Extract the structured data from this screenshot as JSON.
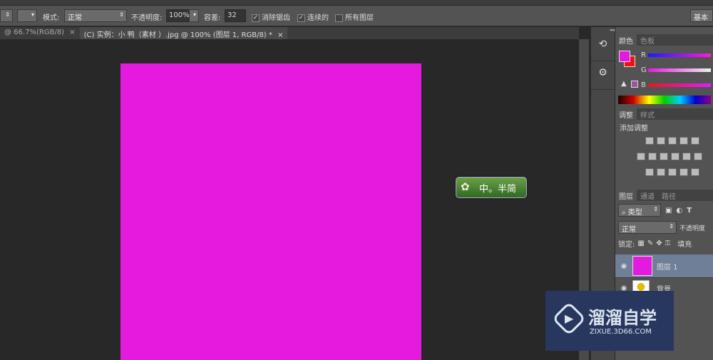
{
  "options": {
    "mode_label": "模式:",
    "mode_value": "正常",
    "opacity_label": "不透明度:",
    "opacity_value": "100%",
    "tolerance_label": "容差:",
    "tolerance_value": "32",
    "antialias_label": "消除锯齿",
    "antialias_checked": true,
    "contiguous_label": "连续的",
    "contiguous_checked": true,
    "all_layers_label": "所有图层",
    "all_layers_checked": false,
    "workspace_label": "基本"
  },
  "tabs": [
    {
      "label": "@ 66.7%(RGB/8)",
      "close": "×"
    },
    {
      "label": "(C) 实例：小 鸭（素材 ）.jpg @ 100% (图层 1, RGB/8) *",
      "close": "×"
    }
  ],
  "color_panel": {
    "tabs": [
      "颜色",
      "色板"
    ],
    "channels": [
      "R",
      "G",
      "B"
    ],
    "fg_color": "#e41adf",
    "bg_color": "#ee1111"
  },
  "adjust_panel": {
    "tabs": [
      "调整",
      "样式"
    ],
    "title": "添加调整"
  },
  "layers_panel": {
    "tabs": [
      "图层",
      "通道",
      "路径"
    ],
    "filter": "类型",
    "blend": "正常",
    "opacity_label": "不透明度",
    "lock_label": "锁定:",
    "fill_label": "填充",
    "layers": [
      {
        "name": "图层 1",
        "selected": true
      },
      {
        "name": "背景",
        "selected": false
      }
    ]
  },
  "badge": {
    "text": "中。半简"
  },
  "watermark": {
    "title": "溜溜自学",
    "url": "ZIXUE.3D66.COM"
  }
}
